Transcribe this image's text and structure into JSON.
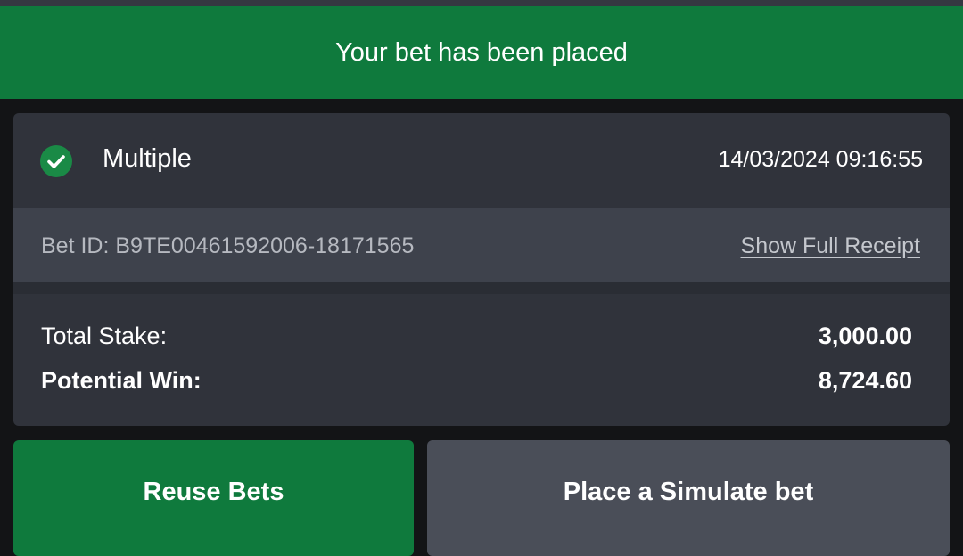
{
  "banner": {
    "message": "Your bet has been placed"
  },
  "bet": {
    "type": "Multiple",
    "datetime": "14/03/2024 09:16:55",
    "id_text": "Bet ID: B9TE00461592006-18171565",
    "receipt_link": "Show Full Receipt",
    "total_stake_label": "Total Stake:",
    "total_stake_value": "3,000.00",
    "potential_win_label": "Potential Win:",
    "potential_win_value": "8,724.60",
    "status_icon": "check-circle-icon"
  },
  "actions": {
    "reuse_label": "Reuse Bets",
    "simulate_label": "Place a Simulate bet"
  },
  "colors": {
    "success_green": "#0f7a3d",
    "card_bg": "#30333b",
    "id_row_bg": "#3e424c",
    "secondary_button": "#4a4e58"
  }
}
